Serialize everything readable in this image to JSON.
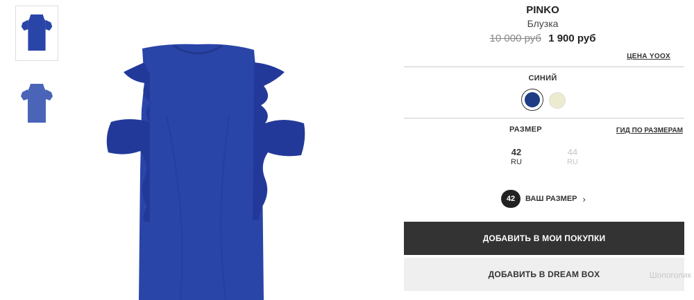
{
  "product": {
    "brand": "PINKO",
    "type": "Блузка",
    "old_price": "10 000 руб",
    "new_price": "1 900 руб",
    "yoox_price_link": "ЦЕНА YOOX"
  },
  "color": {
    "selected_label": "СИНИЙ",
    "swatches": [
      {
        "name": "blue",
        "hex": "#1e3d84",
        "selected": true
      },
      {
        "name": "cream",
        "hex": "#ecebd0",
        "selected": false
      }
    ]
  },
  "size": {
    "title": "РАЗМЕР",
    "guide_link": "ГИД ПО РАЗМЕРАМ",
    "options": [
      {
        "size": "42",
        "region": "RU",
        "available": true
      },
      {
        "size": "44",
        "region": "RU",
        "available": false
      }
    ],
    "your_size_badge": "42",
    "your_size_label": "ВАШ РАЗМЕР"
  },
  "actions": {
    "add_to_cart": "ДОБАВИТЬ В МОИ ПОКУПКИ",
    "add_to_dream_box": "ДОБАВИТЬ В DREAM BOX"
  },
  "watermark": "Шопоголик",
  "colors": {
    "product_blue": "#2a45a8",
    "button_dark": "#333333",
    "button_light": "#efefef"
  }
}
